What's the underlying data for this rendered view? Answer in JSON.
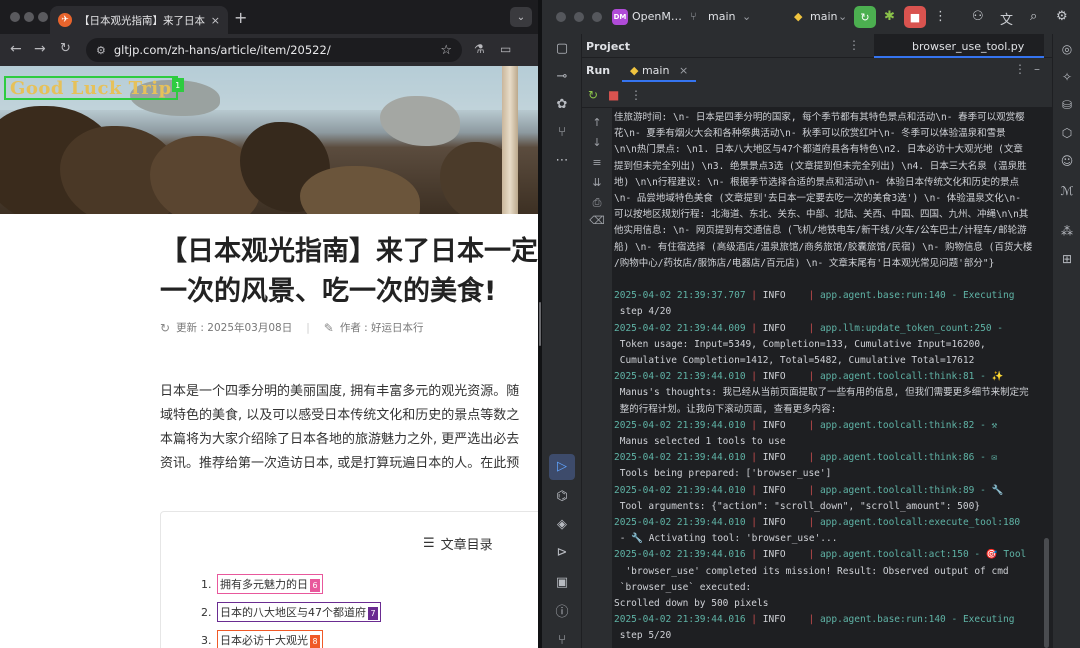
{
  "browser": {
    "tab_title": "【日本观光指南】来了日本一定要",
    "tab_close": "×",
    "new_tab": "+",
    "url_prefix_icon": "site-settings-icon",
    "url": "gltjp.com/zh-hans/article/item/20522/",
    "logo_text": "Good Luck Trip",
    "logo_marker": "1",
    "article": {
      "title_lines": [
        "【日本观光指南】来了日本一定要",
        "一次的风景、吃一次的美食!"
      ],
      "updated": "更新 : 2025年03月08日",
      "author": "作者 : 好运日本行",
      "body_lines": [
        "日本是一个四季分明的美丽国度, 拥有丰富多元的观光资源。随",
        "域特色的美食, 以及可以感受日本传统文化和历史的景点等数之",
        "本篇将为大家介绍除了日本各地的旅游魅力之外, 更严选出必去",
        "资讯。推荐给第一次造访日本, 或是打算玩遍日本的人。在此预"
      ],
      "toc_title": "文章目录",
      "toc": [
        {
          "num": "1.",
          "label": "拥有多元魅力的日",
          "marker": "6",
          "color": "#e8589c"
        },
        {
          "num": "2.",
          "label": "日本的八大地区与47个都道府",
          "marker": "7",
          "color": "#6a2c91"
        },
        {
          "num": "3.",
          "label": "日本必访十大观光",
          "marker": "8",
          "color": "#f05a28"
        }
      ]
    }
  },
  "ide": {
    "project_badge": "DM",
    "project_name": "OpenM…",
    "branch": "main",
    "run_config": "main",
    "project_label": "Project",
    "file_tab": "browser_use_tool.py",
    "run_label": "Run",
    "run_tab": "main",
    "console_lines": [
      {
        "t": "text",
        "s": "佳旅游时间: \\n- 日本是四季分明的国家, 每个季节都有其特色景点和活动\\n- 春季可以观赏樱"
      },
      {
        "t": "text",
        "s": "花\\n- 夏季有烟火大会和各种祭典活动\\n- 秋季可以欣赏红叶\\n- 冬季可以体验温泉和雪景"
      },
      {
        "t": "text",
        "s": "\\n\\n热门景点: \\n1. 日本八大地区与47个都道府县各有特色\\n2. 日本必访十大观光地 (文章"
      },
      {
        "t": "text",
        "s": "提到但未完全列出) \\n3. 绝景景点3选 (文章提到但未完全列出) \\n4. 日本三大名泉 (温泉胜"
      },
      {
        "t": "text",
        "s": "地) \\n\\n行程建议: \\n- 根据季节选择合适的景点和活动\\n- 体验日本传统文化和历史的景点"
      },
      {
        "t": "text",
        "s": "\\n- 品尝地域特色美食 (文章提到'去日本一定要去吃一次的美食3选') \\n- 体验温泉文化\\n-"
      },
      {
        "t": "text",
        "s": "可以按地区规划行程: 北海道、东北、关东、中部、北陆、关西、中国、四国、九州、冲绳\\n\\n其"
      },
      {
        "t": "text",
        "s": "他实用信息: \\n- 网页提到有交通信息 (飞机/地铁电车/新干线/火车/公车巴士/计程车/邮轮游"
      },
      {
        "t": "text",
        "s": "船) \\n- 有住宿选择 (高级酒店/温泉旅馆/商务旅馆/胶囊旅馆/民宿) \\n- 购物信息 (百货大楼"
      },
      {
        "t": "text",
        "s": "/购物中心/药妆店/服饰店/电器店/百元店) \\n- 文章末尾有'日本观光常见问题'部分\"}"
      },
      {
        "t": "blank",
        "s": ""
      },
      {
        "t": "log",
        "ts": "2025-04-02 21:39:37.707",
        "lv": "INFO    ",
        "mod": "app.agent.base:run:140",
        "msg": " - Executing"
      },
      {
        "t": "text",
        "s": " step 4/20"
      },
      {
        "t": "log",
        "ts": "2025-04-02 21:39:44.009",
        "lv": "INFO    ",
        "mod": "app.llm:update_token_count:250",
        "msg": " -"
      },
      {
        "t": "text",
        "s": " Token usage: Input=5349, Completion=133, Cumulative Input=16200,"
      },
      {
        "t": "text",
        "s": " Cumulative Completion=1412, Total=5482, Cumulative Total=17612"
      },
      {
        "t": "log",
        "ts": "2025-04-02 21:39:44.010",
        "lv": "INFO    ",
        "mod": "app.agent.toolcall:think:81",
        "msg": " - ✨"
      },
      {
        "t": "text",
        "s": " Manus's thoughts: 我已经从当前页面提取了一些有用的信息, 但我们需要更多细节来制定完"
      },
      {
        "t": "text",
        "s": " 整的行程计划。让我向下滚动页面, 查看更多内容:"
      },
      {
        "t": "log",
        "ts": "2025-04-02 21:39:44.010",
        "lv": "INFO    ",
        "mod": "app.agent.toolcall:think:82",
        "msg": " - ⚒"
      },
      {
        "t": "text",
        "s": " Manus selected 1 tools to use"
      },
      {
        "t": "log",
        "ts": "2025-04-02 21:39:44.010",
        "lv": "INFO    ",
        "mod": "app.agent.toolcall:think:86",
        "msg": " - ✉"
      },
      {
        "t": "text",
        "s": " Tools being prepared: ['browser_use']"
      },
      {
        "t": "log",
        "ts": "2025-04-02 21:39:44.010",
        "lv": "INFO    ",
        "mod": "app.agent.toolcall:think:89",
        "msg": " - 🔧"
      },
      {
        "t": "text",
        "s": " Tool arguments: {\"action\": \"scroll_down\", \"scroll_amount\": 500}"
      },
      {
        "t": "log",
        "ts": "2025-04-02 21:39:44.010",
        "lv": "INFO    ",
        "mod": "app.agent.toolcall:execute_tool:180",
        "msg": ""
      },
      {
        "t": "text",
        "s": " - 🔧 Activating tool: 'browser_use'..."
      },
      {
        "t": "log",
        "ts": "2025-04-02 21:39:44.016",
        "lv": "INFO    ",
        "mod": "app.agent.toolcall:act:150",
        "msg": " - 🎯 Tool"
      },
      {
        "t": "text",
        "s": "  'browser_use' completed its mission! Result: Observed output of cmd"
      },
      {
        "t": "text",
        "s": " `browser_use` executed:"
      },
      {
        "t": "text",
        "s": "Scrolled down by 500 pixels"
      },
      {
        "t": "log",
        "ts": "2025-04-02 21:39:44.016",
        "lv": "INFO    ",
        "mod": "app.agent.base:run:140",
        "msg": " - Executing"
      },
      {
        "t": "text",
        "s": " step 5/20"
      }
    ]
  }
}
